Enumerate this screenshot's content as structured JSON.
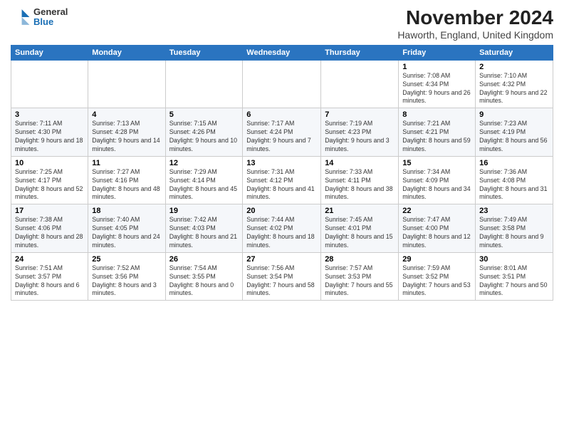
{
  "logo": {
    "general": "General",
    "blue": "Blue"
  },
  "title": "November 2024",
  "subtitle": "Haworth, England, United Kingdom",
  "days_header": [
    "Sunday",
    "Monday",
    "Tuesday",
    "Wednesday",
    "Thursday",
    "Friday",
    "Saturday"
  ],
  "weeks": [
    [
      {
        "day": "",
        "info": ""
      },
      {
        "day": "",
        "info": ""
      },
      {
        "day": "",
        "info": ""
      },
      {
        "day": "",
        "info": ""
      },
      {
        "day": "",
        "info": ""
      },
      {
        "day": "1",
        "info": "Sunrise: 7:08 AM\nSunset: 4:34 PM\nDaylight: 9 hours and 26 minutes."
      },
      {
        "day": "2",
        "info": "Sunrise: 7:10 AM\nSunset: 4:32 PM\nDaylight: 9 hours and 22 minutes."
      }
    ],
    [
      {
        "day": "3",
        "info": "Sunrise: 7:11 AM\nSunset: 4:30 PM\nDaylight: 9 hours and 18 minutes."
      },
      {
        "day": "4",
        "info": "Sunrise: 7:13 AM\nSunset: 4:28 PM\nDaylight: 9 hours and 14 minutes."
      },
      {
        "day": "5",
        "info": "Sunrise: 7:15 AM\nSunset: 4:26 PM\nDaylight: 9 hours and 10 minutes."
      },
      {
        "day": "6",
        "info": "Sunrise: 7:17 AM\nSunset: 4:24 PM\nDaylight: 9 hours and 7 minutes."
      },
      {
        "day": "7",
        "info": "Sunrise: 7:19 AM\nSunset: 4:23 PM\nDaylight: 9 hours and 3 minutes."
      },
      {
        "day": "8",
        "info": "Sunrise: 7:21 AM\nSunset: 4:21 PM\nDaylight: 8 hours and 59 minutes."
      },
      {
        "day": "9",
        "info": "Sunrise: 7:23 AM\nSunset: 4:19 PM\nDaylight: 8 hours and 56 minutes."
      }
    ],
    [
      {
        "day": "10",
        "info": "Sunrise: 7:25 AM\nSunset: 4:17 PM\nDaylight: 8 hours and 52 minutes."
      },
      {
        "day": "11",
        "info": "Sunrise: 7:27 AM\nSunset: 4:16 PM\nDaylight: 8 hours and 48 minutes."
      },
      {
        "day": "12",
        "info": "Sunrise: 7:29 AM\nSunset: 4:14 PM\nDaylight: 8 hours and 45 minutes."
      },
      {
        "day": "13",
        "info": "Sunrise: 7:31 AM\nSunset: 4:12 PM\nDaylight: 8 hours and 41 minutes."
      },
      {
        "day": "14",
        "info": "Sunrise: 7:33 AM\nSunset: 4:11 PM\nDaylight: 8 hours and 38 minutes."
      },
      {
        "day": "15",
        "info": "Sunrise: 7:34 AM\nSunset: 4:09 PM\nDaylight: 8 hours and 34 minutes."
      },
      {
        "day": "16",
        "info": "Sunrise: 7:36 AM\nSunset: 4:08 PM\nDaylight: 8 hours and 31 minutes."
      }
    ],
    [
      {
        "day": "17",
        "info": "Sunrise: 7:38 AM\nSunset: 4:06 PM\nDaylight: 8 hours and 28 minutes."
      },
      {
        "day": "18",
        "info": "Sunrise: 7:40 AM\nSunset: 4:05 PM\nDaylight: 8 hours and 24 minutes."
      },
      {
        "day": "19",
        "info": "Sunrise: 7:42 AM\nSunset: 4:03 PM\nDaylight: 8 hours and 21 minutes."
      },
      {
        "day": "20",
        "info": "Sunrise: 7:44 AM\nSunset: 4:02 PM\nDaylight: 8 hours and 18 minutes."
      },
      {
        "day": "21",
        "info": "Sunrise: 7:45 AM\nSunset: 4:01 PM\nDaylight: 8 hours and 15 minutes."
      },
      {
        "day": "22",
        "info": "Sunrise: 7:47 AM\nSunset: 4:00 PM\nDaylight: 8 hours and 12 minutes."
      },
      {
        "day": "23",
        "info": "Sunrise: 7:49 AM\nSunset: 3:58 PM\nDaylight: 8 hours and 9 minutes."
      }
    ],
    [
      {
        "day": "24",
        "info": "Sunrise: 7:51 AM\nSunset: 3:57 PM\nDaylight: 8 hours and 6 minutes."
      },
      {
        "day": "25",
        "info": "Sunrise: 7:52 AM\nSunset: 3:56 PM\nDaylight: 8 hours and 3 minutes."
      },
      {
        "day": "26",
        "info": "Sunrise: 7:54 AM\nSunset: 3:55 PM\nDaylight: 8 hours and 0 minutes."
      },
      {
        "day": "27",
        "info": "Sunrise: 7:56 AM\nSunset: 3:54 PM\nDaylight: 7 hours and 58 minutes."
      },
      {
        "day": "28",
        "info": "Sunrise: 7:57 AM\nSunset: 3:53 PM\nDaylight: 7 hours and 55 minutes."
      },
      {
        "day": "29",
        "info": "Sunrise: 7:59 AM\nSunset: 3:52 PM\nDaylight: 7 hours and 53 minutes."
      },
      {
        "day": "30",
        "info": "Sunrise: 8:01 AM\nSunset: 3:51 PM\nDaylight: 7 hours and 50 minutes."
      }
    ]
  ]
}
